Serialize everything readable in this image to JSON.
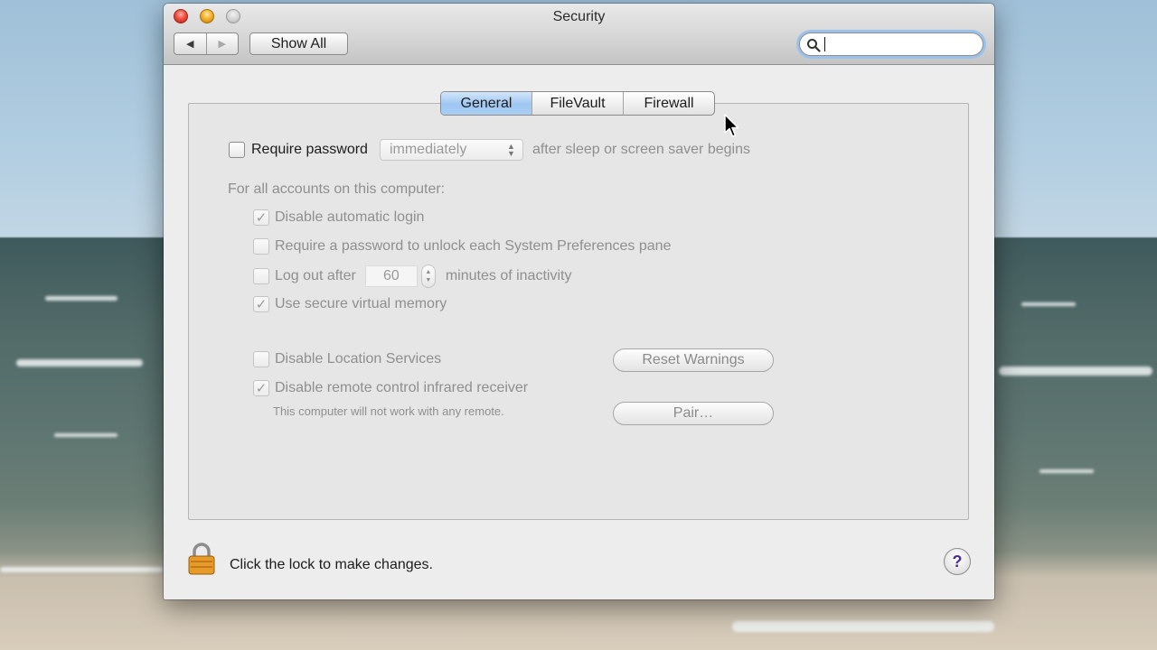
{
  "window": {
    "title": "Security"
  },
  "toolbar": {
    "back_glyph": "◀",
    "forward_glyph": "▶",
    "show_all_label": "Show All",
    "search_value": "",
    "search_placeholder": ""
  },
  "tabs": [
    {
      "label": "General",
      "active": true
    },
    {
      "label": "FileVault",
      "active": false
    },
    {
      "label": "Firewall",
      "active": false
    }
  ],
  "general": {
    "require_password": {
      "checked": false,
      "label": "Require password",
      "delay_value": "immediately",
      "suffix": "after sleep or screen saver begins"
    },
    "all_accounts_heading": "For all accounts on this computer:",
    "disable_auto_login": {
      "checked": true,
      "label": "Disable automatic login"
    },
    "require_password_prefs": {
      "checked": false,
      "label": "Require a password to unlock each System Preferences pane"
    },
    "logout": {
      "checked": false,
      "label": "Log out after",
      "minutes": "60",
      "suffix": "minutes of inactivity"
    },
    "secure_vm": {
      "checked": true,
      "label": "Use secure virtual memory"
    },
    "disable_location": {
      "checked": false,
      "label": "Disable Location Services"
    },
    "reset_warnings_label": "Reset Warnings",
    "disable_ir": {
      "checked": true,
      "label": "Disable remote control infrared receiver"
    },
    "ir_note": "This computer will not work with any remote.",
    "pair_label": "Pair…"
  },
  "footer": {
    "lock_text": "Click the lock to make changes.",
    "help_glyph": "?"
  },
  "icons": {
    "search": "search-icon",
    "lock": "lock-icon",
    "help": "help-icon",
    "cursor": "mouse-pointer-icon"
  },
  "colors": {
    "active_tab": "#9ec6f1",
    "search_focus_ring": "#9cc2ea",
    "close_button": "#f0503f",
    "minimize_button": "#f6b12d",
    "help_glyph": "#4c2d94"
  }
}
